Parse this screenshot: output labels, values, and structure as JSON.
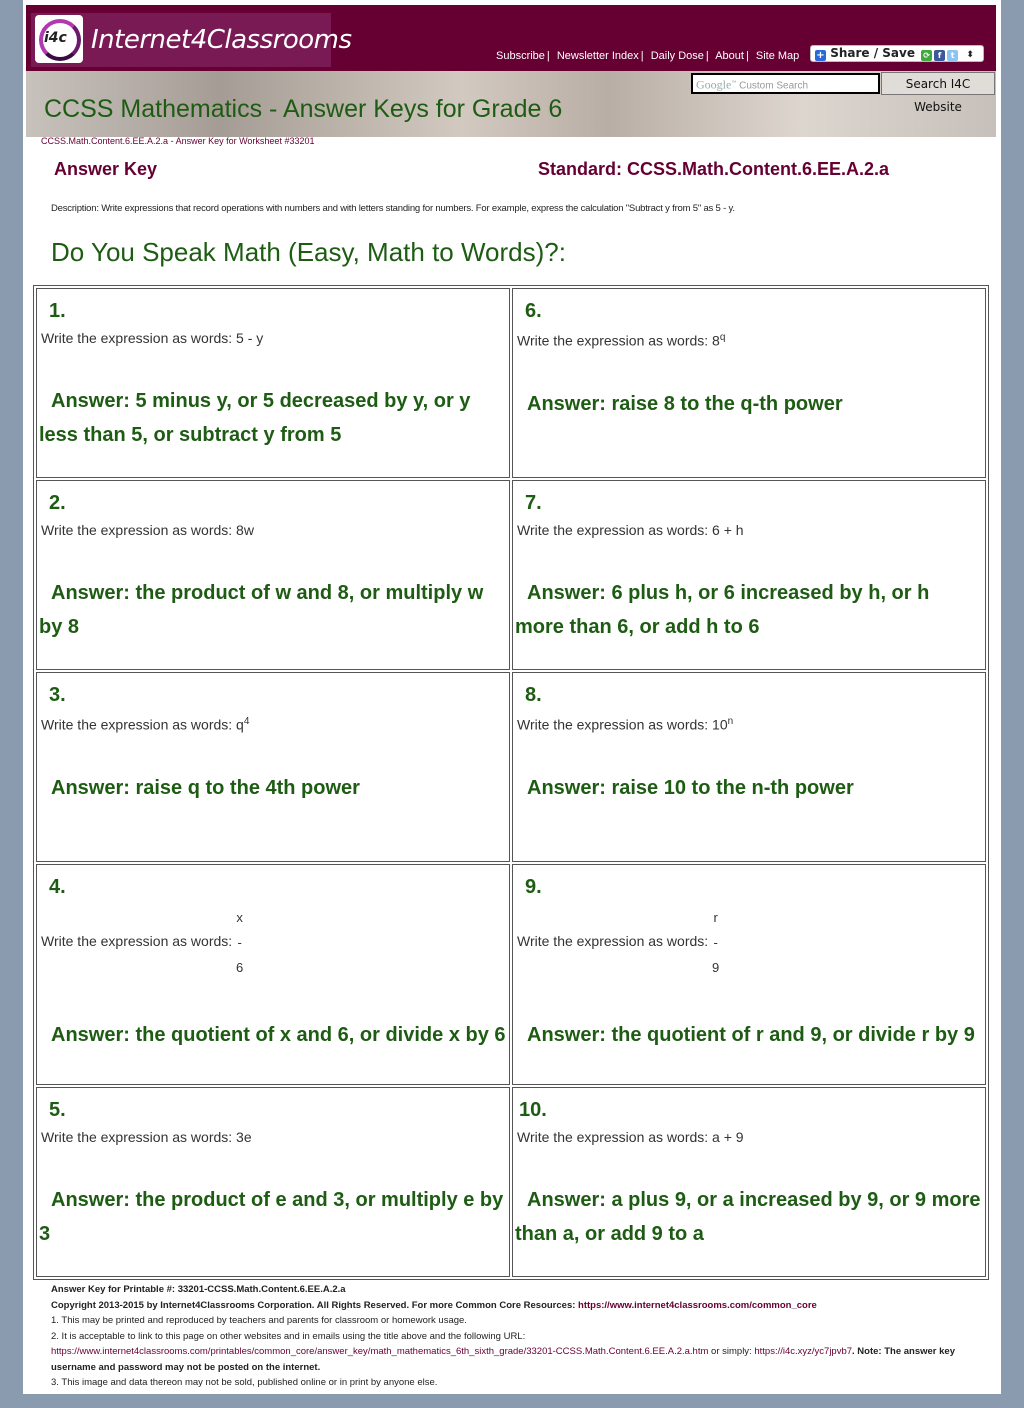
{
  "header": {
    "logo_icon_text": "i4c",
    "logo_text": "Internet4Classrooms",
    "nav": [
      "Subscribe",
      "Newsletter Index",
      "Daily Dose",
      "About",
      "Site Map"
    ],
    "share_label": "Share / Save",
    "search_placeholder_brand": "Google",
    "search_placeholder": "Custom Search",
    "search_button": "Search I4C Website"
  },
  "page_title": "CCSS Mathematics - Answer Keys for Grade 6",
  "breadcrumb": "CCSS.Math.Content.6.EE.A.2.a - Answer Key for Worksheet #33201",
  "answer_key_label": "Answer Key",
  "standard_label": "Standard: CCSS.Math.Content.6.EE.A.2.a",
  "description": "Description: Write expressions that record operations with numbers and with letters standing for numbers. For example, express the calculation \"Subtract y from 5\" as 5 - y.",
  "worksheet_title": "Do You Speak Math (Easy, Math to Words)?:",
  "prompt_prefix": "Write the expression as words:",
  "questions": [
    {
      "num": "1.",
      "expr": "5 - y",
      "answer": "Answer: 5 minus y, or 5 decreased by y, or y less than 5, or subtract y from 5"
    },
    {
      "num": "6.",
      "expr_base": "8",
      "expr_sup": "q",
      "answer": "Answer: raise 8 to the q-th power"
    },
    {
      "num": "2.",
      "expr": "8w",
      "answer": "Answer: the product of w and 8, or multiply w by 8"
    },
    {
      "num": "7.",
      "expr": "6 + h",
      "answer": "Answer: 6 plus h, or 6 increased by h, or h more than 6, or add h to 6"
    },
    {
      "num": "3.",
      "expr_base": "q",
      "expr_sup": "4",
      "answer": "Answer: raise q to the 4th power"
    },
    {
      "num": "8.",
      "expr_base": "10",
      "expr_sup": "n",
      "answer": "Answer: raise 10 to the n-th power"
    },
    {
      "num": "4.",
      "frac_num": "x",
      "frac_bar": "-",
      "frac_den": "6",
      "answer": "Answer: the quotient of x and 6, or divide x by 6"
    },
    {
      "num": "9.",
      "frac_num": "r",
      "frac_bar": "-",
      "frac_den": "9",
      "answer": "Answer: the quotient of r and 9, or divide r by 9"
    },
    {
      "num": "5.",
      "expr": "3e",
      "answer": "Answer: the product of e and 3, or multiply e by 3"
    },
    {
      "num": "10.",
      "expr": "a + 9",
      "answer": "Answer: a plus 9, or a increased by 9, or 9 more than a, or add 9 to a"
    }
  ],
  "footer": {
    "printable": "Answer Key for Printable #: 33201-CCSS.Math.Content.6.EE.A.2.a",
    "copyright": "Copyright 2013-2015 by Internet4Classrooms Corporation. All Rights Reserved. For more Common Core Resources:",
    "copyright_link": "https://www.internet4classrooms.com/common_core",
    "note1": "1. This may be printed and reproduced by teachers and parents for classroom or homework usage.",
    "note2": "2. It is acceptable to link to this page on other websites and in emails using the title above and the following URL:",
    "url_long": "https://www.internet4classrooms.com/printables/common_core/answer_key/math_mathematics_6th_sixth_grade/33201-CCSS.Math.Content.6.EE.A.2.a.htm",
    "or_simply": " or simply: ",
    "url_short": "https://i4c.xyz/yc7jpvb7",
    "note_warning": ". Note: The answer key username and password may not be posted on the internet.",
    "note3": "3. This image and data thereon may not be sold, published online or in print by anyone else."
  }
}
